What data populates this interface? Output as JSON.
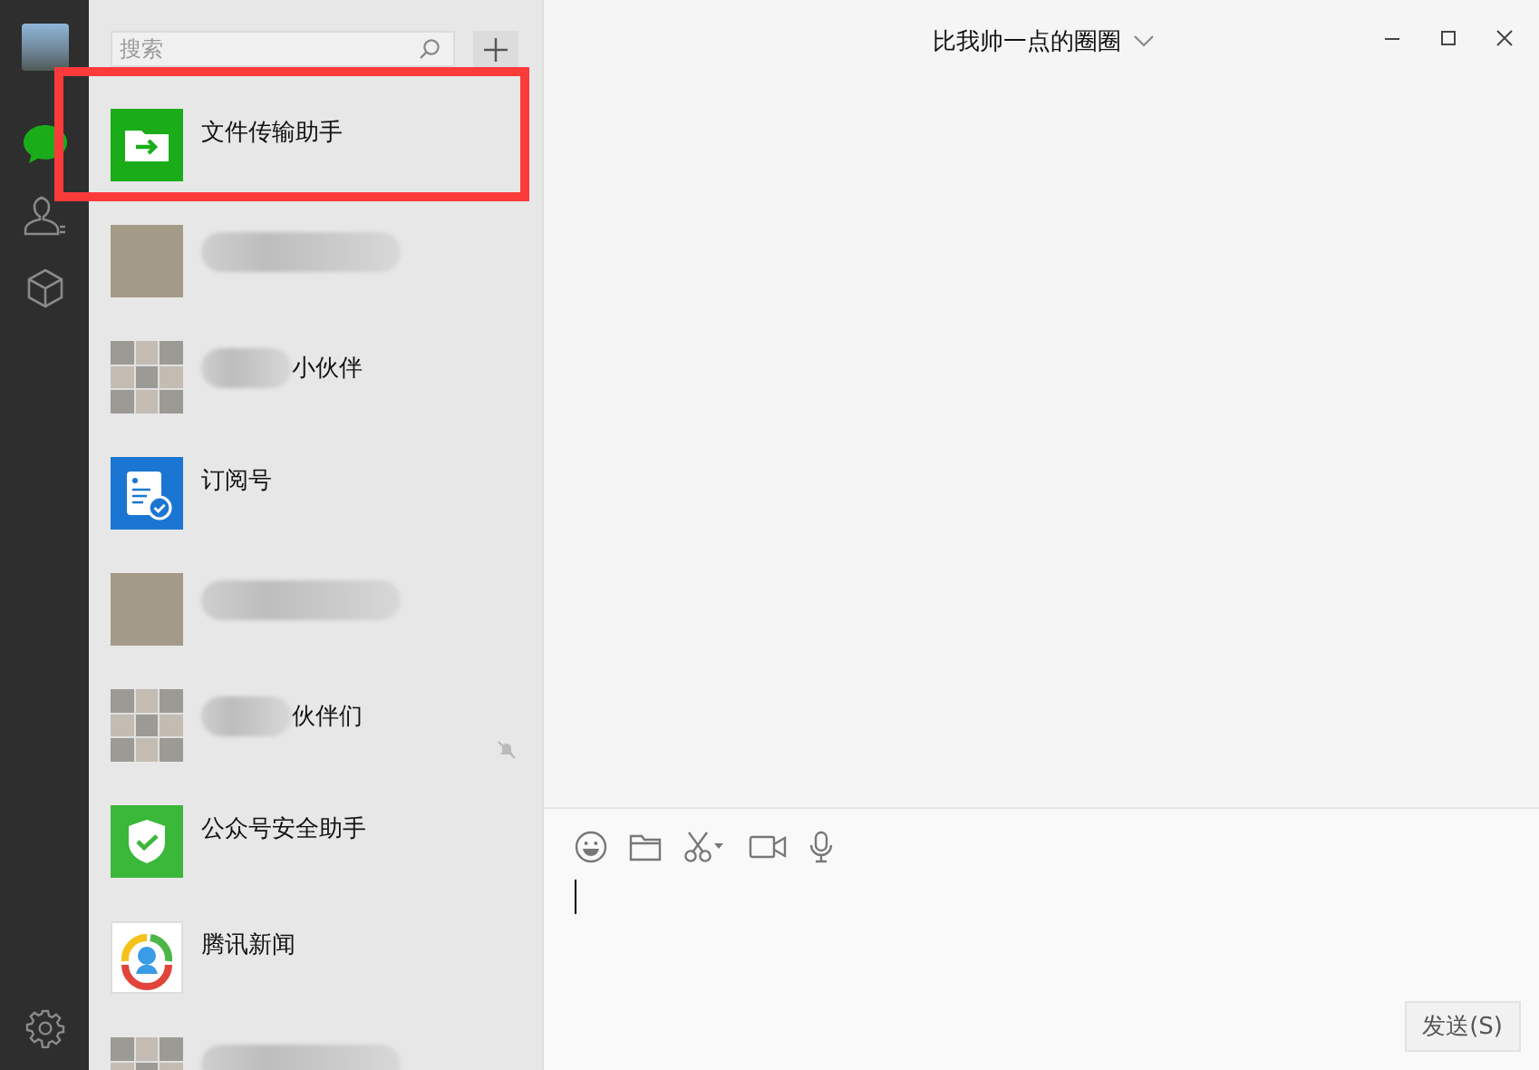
{
  "sidebar": {
    "items": [
      {
        "kind": "chats",
        "selected": true
      },
      {
        "kind": "contacts",
        "selected": false
      },
      {
        "kind": "favorites",
        "selected": false
      }
    ]
  },
  "search": {
    "placeholder": "搜索"
  },
  "chats": [
    {
      "kind": "file-transfer",
      "name": "文件传输助手",
      "name_blurred": false,
      "muted": false,
      "highlighted": true
    },
    {
      "kind": "photo",
      "name_blurred": true,
      "muted": false,
      "highlighted": false
    },
    {
      "kind": "group",
      "name": "小伙伴",
      "name_blurred": true,
      "muted": false,
      "highlighted": false
    },
    {
      "kind": "subscription",
      "name": "订阅号",
      "name_blurred": false,
      "muted": false,
      "highlighted": false
    },
    {
      "kind": "photo",
      "name_blurred": true,
      "muted": false,
      "highlighted": false
    },
    {
      "kind": "group",
      "name": "伙伴们",
      "name_blurred": true,
      "muted": true,
      "highlighted": false
    },
    {
      "kind": "shield",
      "name": "公众号安全助手",
      "name_blurred": false,
      "muted": false,
      "highlighted": false
    },
    {
      "kind": "news",
      "name": "腾讯新闻",
      "name_blurred": false,
      "muted": false,
      "highlighted": false
    },
    {
      "kind": "group",
      "name_blurred": true,
      "muted": false,
      "highlighted": false
    }
  ],
  "conversation": {
    "title": "比我帅一点的圈圈",
    "send_button": "发送(S)"
  }
}
